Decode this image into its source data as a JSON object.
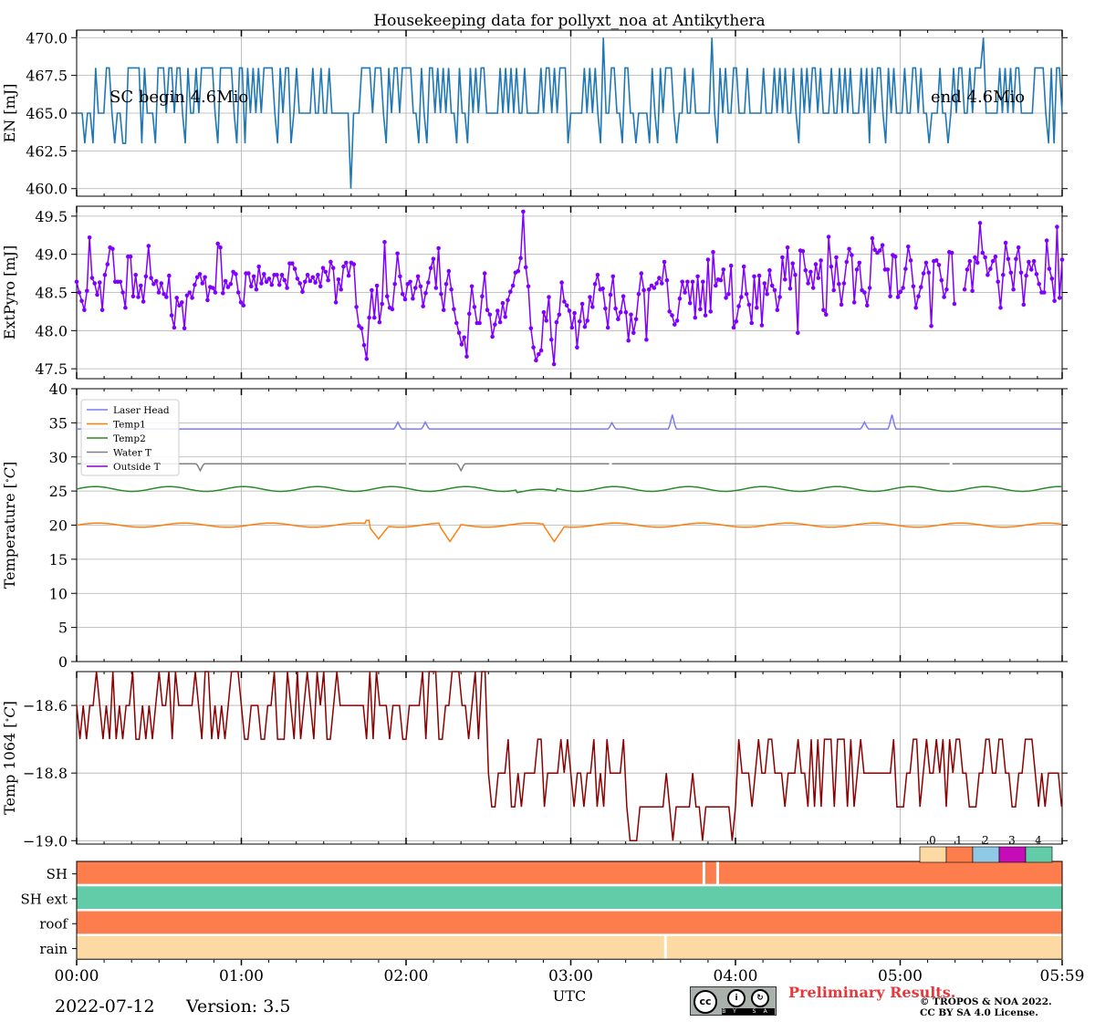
{
  "title": "Housekeeping data for pollyxt_noa at Antikythera",
  "date": "2022-07-12",
  "version": "Version: 3.5",
  "xlabel": "UTC",
  "xticks": [
    "00:00",
    "01:00",
    "02:00",
    "03:00",
    "04:00",
    "05:00",
    "05:59"
  ],
  "preliminary": "Preliminary Results.",
  "copyright_line1": "© TROPOS & NOA 2022.",
  "copyright_line2": "CC BY SA 4.0 License.",
  "cc_badge": {
    "cc": "cc",
    "by": "BY",
    "sa": "SA"
  },
  "chart_data": [
    {
      "type": "line",
      "ylabel": "EN [mJ]",
      "ylim": [
        459.5,
        470.5
      ],
      "yticks": [
        "470.0",
        "467.5",
        "465.0",
        "462.5",
        "460.0"
      ],
      "annotations": [
        "SC begin 4.6Mio",
        "end 4.6Mio"
      ],
      "color": "#1f77b4",
      "x_range_minutes": [
        0,
        359
      ],
      "values": [
        465,
        465,
        465,
        463,
        465,
        465,
        463,
        468,
        465,
        465,
        465,
        468,
        468,
        465,
        463,
        465,
        465,
        463,
        463,
        468,
        468,
        468,
        468,
        468,
        463,
        468,
        465,
        465,
        465,
        463,
        468,
        468,
        468,
        465,
        468,
        468,
        465,
        468,
        468,
        465,
        463,
        468,
        465,
        465,
        468,
        465,
        468,
        468,
        468,
        468,
        468,
        465,
        463,
        468,
        468,
        468,
        468,
        468,
        465,
        463,
        468,
        468,
        463,
        468,
        465,
        468,
        465,
        468,
        465,
        468,
        468,
        468,
        468,
        465,
        463,
        468,
        465,
        468,
        468,
        463,
        465,
        468,
        465,
        465,
        465,
        465,
        465,
        468,
        465,
        465,
        468,
        465,
        465,
        468,
        465,
        465,
        465,
        465,
        465,
        465,
        465,
        460,
        465,
        465,
        465,
        468,
        468,
        468,
        468,
        465,
        468,
        468,
        468,
        465,
        463,
        468,
        465,
        468,
        468,
        465,
        468,
        468,
        468,
        468,
        465,
        465,
        463,
        468,
        465,
        463,
        468,
        468,
        465,
        468,
        465,
        468,
        465,
        468,
        465,
        465,
        463,
        468,
        465,
        465,
        463,
        468,
        465,
        468,
        465,
        468,
        468,
        465,
        465,
        465,
        465,
        465,
        468,
        465,
        468,
        465,
        468,
        465,
        468,
        465,
        465,
        468,
        465,
        465,
        465,
        465,
        465,
        468,
        465,
        468,
        468,
        465,
        468,
        465,
        468,
        468,
        468,
        463,
        465,
        465,
        465,
        465,
        465,
        468,
        465,
        468,
        465,
        468,
        465,
        463,
        470,
        465,
        465,
        468,
        468,
        465,
        465,
        463,
        468,
        468,
        465,
        465,
        463,
        465,
        465,
        465,
        465,
        463,
        468,
        465,
        463,
        468,
        465,
        468,
        468,
        468,
        465,
        463,
        465,
        465,
        468,
        465,
        465,
        468,
        465,
        465,
        465,
        465,
        465,
        465,
        470,
        465,
        463,
        468,
        465,
        468,
        465,
        465,
        468,
        468,
        465,
        465,
        465,
        468,
        465,
        465,
        465,
        465,
        465,
        468,
        465,
        465,
        465,
        468,
        465,
        468,
        465,
        468,
        465,
        465,
        468,
        465,
        463,
        468,
        465,
        468,
        465,
        468,
        468,
        465,
        468,
        465,
        465,
        465,
        468,
        465,
        465,
        468,
        465,
        468,
        465,
        468,
        465,
        465,
        465,
        468,
        465,
        468,
        463,
        468,
        465,
        468,
        468,
        465,
        463,
        468,
        465,
        468,
        465,
        465,
        465,
        468,
        465,
        465,
        468,
        468,
        465,
        468,
        465,
        465,
        463,
        465,
        465,
        465,
        468,
        465,
        465,
        463,
        465,
        468,
        465,
        468,
        468,
        465,
        465,
        468,
        465,
        468,
        468,
        468,
        470,
        465,
        465,
        465,
        465,
        465,
        468,
        465,
        468,
        465,
        468,
        465,
        468,
        468,
        465,
        465,
        465,
        465,
        465,
        468,
        468,
        468,
        468,
        465,
        463,
        468,
        463,
        468,
        468,
        465
      ]
    },
    {
      "type": "line",
      "ylabel": "ExtPyro [mJ]",
      "ylim": [
        47.37,
        49.63
      ],
      "yticks": [
        "49.5",
        "49.0",
        "48.5",
        "48.0",
        "47.5"
      ],
      "color": "#7f00ff",
      "marker": "dot",
      "x_range_minutes": [
        0,
        359
      ],
      "values": [
        48.64,
        48.5,
        48.39,
        48.27,
        48.52,
        49.22,
        48.69,
        48.62,
        48.47,
        48.63,
        48.27,
        48.73,
        48.87,
        49.09,
        49.07,
        48.64,
        48.64,
        48.64,
        48.5,
        48.3,
        48.97,
        48.97,
        48.45,
        48.73,
        48.44,
        48.59,
        48.38,
        48.71,
        49.11,
        48.69,
        48.61,
        48.65,
        48.5,
        48.62,
        48.48,
        48.44,
        48.72,
        48.2,
        48.04,
        48.43,
        48.33,
        48.37,
        48.03,
        48.46,
        48.5,
        48.43,
        48.6,
        48.7,
        48.74,
        48.62,
        48.7,
        48.4,
        48.57,
        48.56,
        48.5,
        49.14,
        49.09,
        48.49,
        48.65,
        48.57,
        48.61,
        48.77,
        48.74,
        48.5,
        48.37,
        48.33,
        48.75,
        48.75,
        48.58,
        48.71,
        48.54,
        48.84,
        48.62,
        48.74,
        48.64,
        48.68,
        48.6,
        48.73,
        48.73,
        48.6,
        48.73,
        48.66,
        48.56,
        48.88,
        48.88,
        48.81,
        48.68,
        48.62,
        48.51,
        48.64,
        48.73,
        48.65,
        48.7,
        48.63,
        48.73,
        48.58,
        48.82,
        48.77,
        48.66,
        48.9,
        48.82,
        48.37,
        48.67,
        48.54,
        48.84,
        48.89,
        48.72,
        48.89,
        48.87,
        48.31,
        48.06,
        48.03,
        47.81,
        47.63,
        48.17,
        48.53,
        48.17,
        48.59,
        48.11,
        48.35,
        49.16,
        48.45,
        48.3,
        48.28,
        48.61,
        49.01,
        48.71,
        48.48,
        48.41,
        48.61,
        48.64,
        48.42,
        48.56,
        48.71,
        48.58,
        48.32,
        48.49,
        48.63,
        48.82,
        48.94,
        48.56,
        49.08,
        48.48,
        48.27,
        48.61,
        48.78,
        48.54,
        48.28,
        48.1,
        47.97,
        47.82,
        47.91,
        47.66,
        48.22,
        48.58,
        48.31,
        48.1,
        48.1,
        48.45,
        48.75,
        48.27,
        48.21,
        47.92,
        48.08,
        48.26,
        48.11,
        48.36,
        48.18,
        48.4,
        48.51,
        48.59,
        48.76,
        48.78,
        48.95,
        49.56,
        48.83,
        48.58,
        48.03,
        47.78,
        47.61,
        47.69,
        47.74,
        48.24,
        48.13,
        48.44,
        47.88,
        47.56,
        48.11,
        48.21,
        48.63,
        48.38,
        48.33,
        48.26,
        48.04,
        48.23,
        47.78,
        48.12,
        48.35,
        48.05,
        48.13,
        48.44,
        48.31,
        48.61,
        48.73,
        48.54,
        48.55,
        48.29,
        48.04,
        48.47,
        48.71,
        48.29,
        48.15,
        48.24,
        48.45,
        48.24,
        47.87,
        48.21,
        47.97,
        48.15,
        48.48,
        48.75,
        48.53,
        47.88,
        48.54,
        48.59,
        48.56,
        48.62,
        48.69,
        48.62,
        48.9,
        48.66,
        48.25,
        48.2,
        48.08,
        48.13,
        48.42,
        48.64,
        48.5,
        48.64,
        48.36,
        48.64,
        48.17,
        48.71,
        48.28,
        48.64,
        48.2,
        48.93,
        48.25,
        49.03,
        48.59,
        48.67,
        48.66,
        48.8,
        48.43,
        48.48,
        48.85,
        48.04,
        48.12,
        48.32,
        48.44,
        48.84,
        48.48,
        48.34,
        48.1,
        48.71,
        48.3,
        48.72,
        48.07,
        48.62,
        48.48,
        48.79,
        48.59,
        48.53,
        48.27,
        48.44,
        48.96,
        48.67,
        49.09,
        48.55,
        48.88,
        48.73,
        47.97,
        49.05,
        49.04,
        48.79,
        48.62,
        48.77,
        48.56,
        48.87,
        48.69,
        48.92,
        48.27,
        48.21,
        49.23,
        48.84,
        48.53,
        48.96,
        48.61,
        48.34,
        48.62,
        48.9,
        49.07,
        48.99,
        48.37,
        48.8,
        48.89,
        48.53,
        48.5,
        48.33,
        48.56,
        49.21,
        49.06,
        49.02,
        49.05,
        49.12,
        48.8,
        48.8,
        48.45,
        48.99,
        48.97,
        48.44,
        48.51,
        48.56,
        48.81,
        49.1,
        48.92,
        48.58,
        48.3,
        48.45,
        48.57,
        48.75,
        48.89,
        48.76,
        48.06,
        48.91,
        48.92,
        48.86,
        48.66,
        48.44,
        48.54,
        49.03,
        49.02,
        48.35,
        48.57,
        48.84,
        48.79,
        48.54,
        48.8,
        48.91,
        48.52,
        48.96,
        48.89,
        49.41,
        49.02,
        48.96,
        48.73,
        48.81,
        48.91,
        48.97,
        48.64,
        48.3,
        48.73,
        49.15,
        48.94,
        48.76,
        48.54,
        48.94,
        49.09,
        48.76,
        48.34,
        48.72,
        48.9,
        48.8,
        48.91,
        48.74,
        48.61,
        48.5,
        48.5,
        49.18,
        48.81,
        48.68,
        48.39,
        49.36,
        48.43,
        48.93
      ],
      "gaps_minutes": [
        [
          320,
          323
        ]
      ]
    },
    {
      "type": "line",
      "ylabel": "Temperature [$^\\circ C$]",
      "ylim": [
        0,
        40
      ],
      "yticks": [
        "40",
        "35",
        "30",
        "25",
        "20",
        "15",
        "10",
        "5",
        "0"
      ],
      "legend_position": "top-left",
      "series": [
        {
          "name": "Laser Head",
          "color": "#7b7bf5",
          "base": 34.1,
          "spikes": [
            [
              117,
              35.1
            ],
            [
              127,
              35.1
            ],
            [
              195,
              35.0
            ],
            [
              217,
              36.2
            ],
            [
              287,
              35.1
            ],
            [
              297,
              36.2
            ]
          ]
        },
        {
          "name": "Temp1",
          "color": "#ff7f0e",
          "base": 20.0
        },
        {
          "name": "Temp2",
          "color": "#2a8a2a",
          "base": 25.3
        },
        {
          "name": "Water T",
          "color": "#808080",
          "base": 29.0,
          "spikes": [
            [
              45,
              28.0
            ],
            [
              140,
              28.0
            ]
          ],
          "gaps_minutes": [
            [
              120,
              121
            ],
            [
              194,
              195
            ],
            [
              318,
              319
            ]
          ]
        },
        {
          "name": "Outside T",
          "color": "#8b00c9",
          "values": []
        }
      ]
    },
    {
      "type": "line",
      "ylabel": "Temp 1064 [$^\\circ C$]",
      "ylim": [
        -19.01,
        -18.5
      ],
      "yticks": [
        "−18.6",
        "−18.8",
        "−19.0"
      ],
      "color": "#8b0000",
      "x_range_minutes": [
        0,
        359
      ]
    },
    {
      "type": "heatmap",
      "rows": [
        "SH",
        "SH ext",
        "roof",
        "rain"
      ],
      "legend_labels": [
        "0",
        "1",
        "2",
        "3",
        "4"
      ],
      "legend_colors": [
        "#fdd9a3",
        "#fe7d4d",
        "#8fc9e6",
        "#c60cb9",
        "#62cba7"
      ],
      "row_states": [
        [
          {
            "from": 0,
            "to": 228,
            "state": 1
          },
          {
            "from": 229,
            "to": 233,
            "state": 1
          },
          {
            "from": 234,
            "to": 359,
            "state": 1
          }
        ],
        [
          {
            "from": 0,
            "to": 359,
            "state": 4
          }
        ],
        [
          {
            "from": 0,
            "to": 359,
            "state": 1
          }
        ],
        [
          {
            "from": 0,
            "to": 214,
            "state": 0
          },
          {
            "from": 215,
            "to": 359,
            "state": 0
          }
        ]
      ]
    }
  ]
}
